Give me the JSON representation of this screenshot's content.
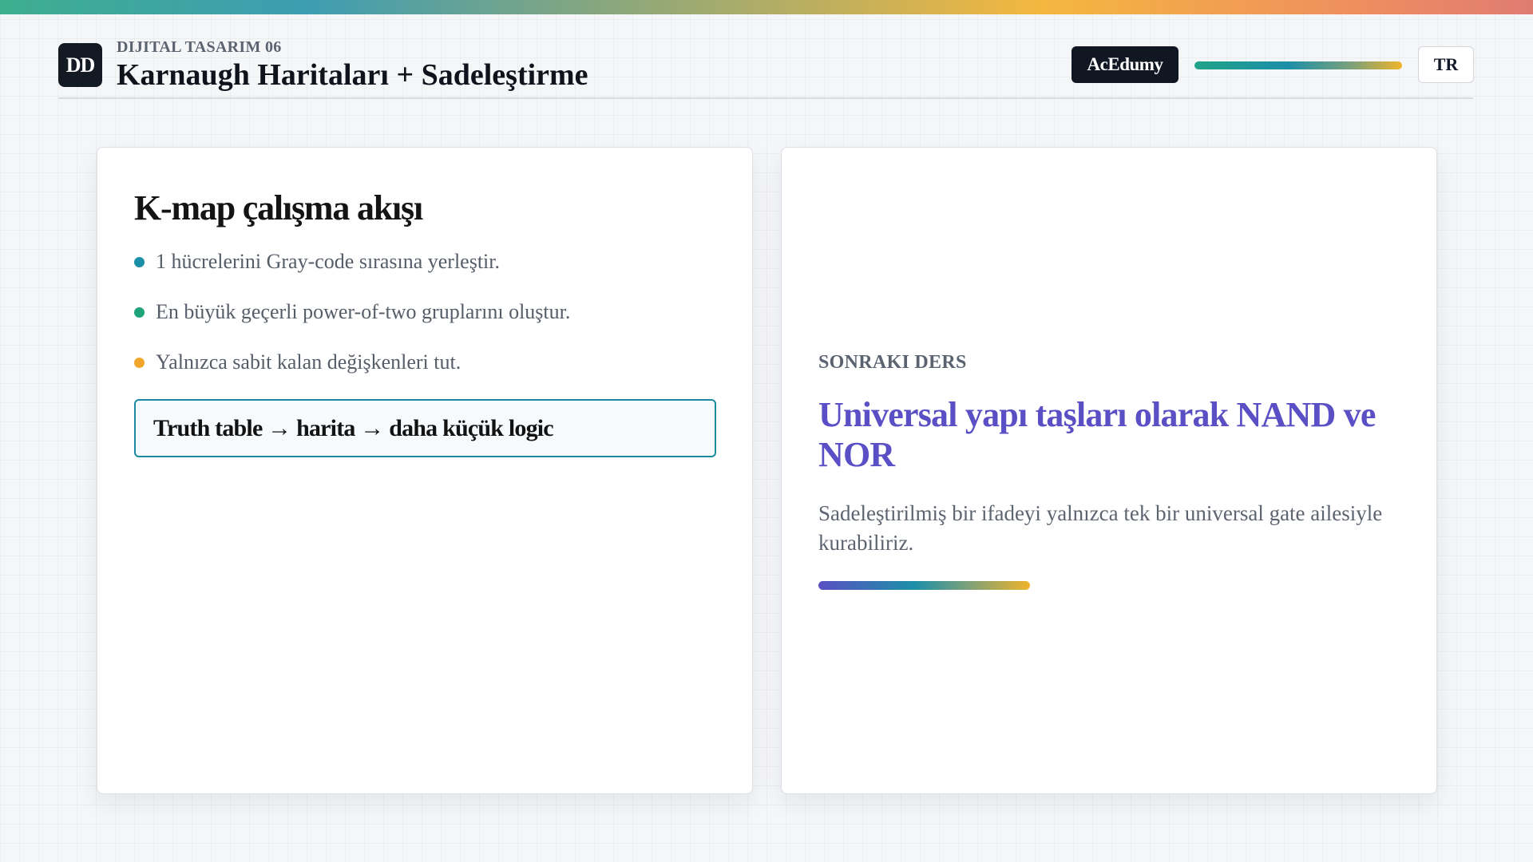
{
  "header": {
    "logo_text": "DD",
    "kicker": "DIJITAL TASARIM 06",
    "title": "Karnaugh Haritaları + Sadeleştirme",
    "brand": "AcEdumy",
    "language": "TR"
  },
  "left_card": {
    "title": "K-map çalışma akışı",
    "bullets": [
      {
        "text": "1 hücrelerini Gray-code sırasına yerleştir.",
        "color": "#1c8fa8"
      },
      {
        "text": "En büyük geçerli power-of-two gruplarını oluştur.",
        "color": "#1fa37a"
      },
      {
        "text": "Yalnızca sabit kalan değişkenleri tut.",
        "color": "#f2a52b"
      }
    ],
    "callout": "Truth table → harita → daha küçük logic"
  },
  "right_card": {
    "kicker": "SONRAKI DERS",
    "title": "Universal yapı taşları olarak NAND ve NOR",
    "description": "Sadeleştirilmiş bir ifadeyi yalnızca tek bir universal gate ailesiyle kurabiliriz."
  },
  "colors": {
    "accent_teal": "#1c8fa8",
    "accent_purple": "#5a4fc4",
    "accent_gold": "#eeb42a"
  }
}
